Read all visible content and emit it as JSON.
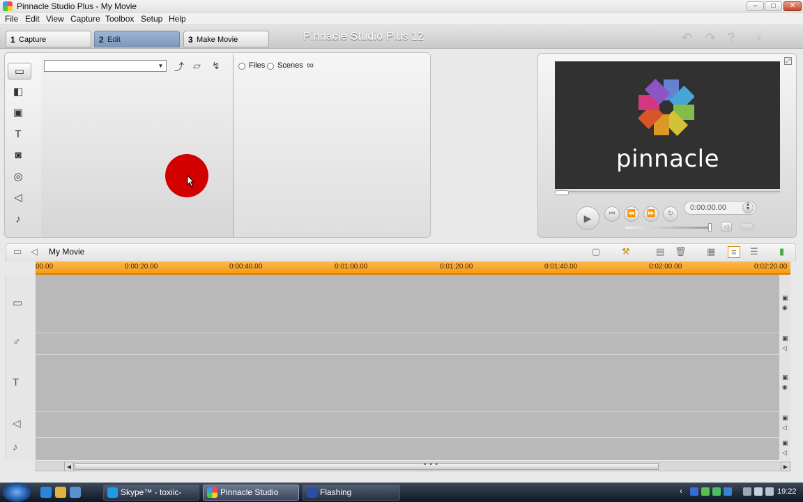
{
  "window": {
    "title": "Pinnacle Studio Plus - My Movie",
    "minimize": "–",
    "maximize": "□",
    "close": "✕"
  },
  "menu": [
    "File",
    "Edit",
    "View",
    "Capture",
    "Toolbox",
    "Setup",
    "Help"
  ],
  "tabs": [
    {
      "num": "1",
      "label": "Capture"
    },
    {
      "num": "2",
      "label": "Edit"
    },
    {
      "num": "3",
      "label": "Make Movie"
    }
  ],
  "brand": "Pinnacle Studio Plus 12",
  "library": {
    "combo_value": "",
    "radio_files": "Files",
    "radio_scenes": "Scenes"
  },
  "preview": {
    "logo_text": "pinnacle",
    "timecode": "0:00:00.00",
    "dvd_label": "DVD"
  },
  "timeline": {
    "title": "My Movie",
    "ruler": [
      "00.00",
      "0:00:20.00",
      "0:00:40.00",
      "0:01:00.00",
      "0:01:20.00",
      "0:01:40.00",
      "0:02:00.00",
      "0:02:20.00"
    ]
  },
  "taskbar": {
    "buttons": [
      "Skype™ - toxiic-psy...",
      "Pinnacle Studio Plus...",
      "Flashing"
    ],
    "clock": "19:22"
  },
  "colors": {
    "ruler": "#f59a15",
    "record_dot": "#d30000",
    "active_tab": "#8aa5c4"
  }
}
